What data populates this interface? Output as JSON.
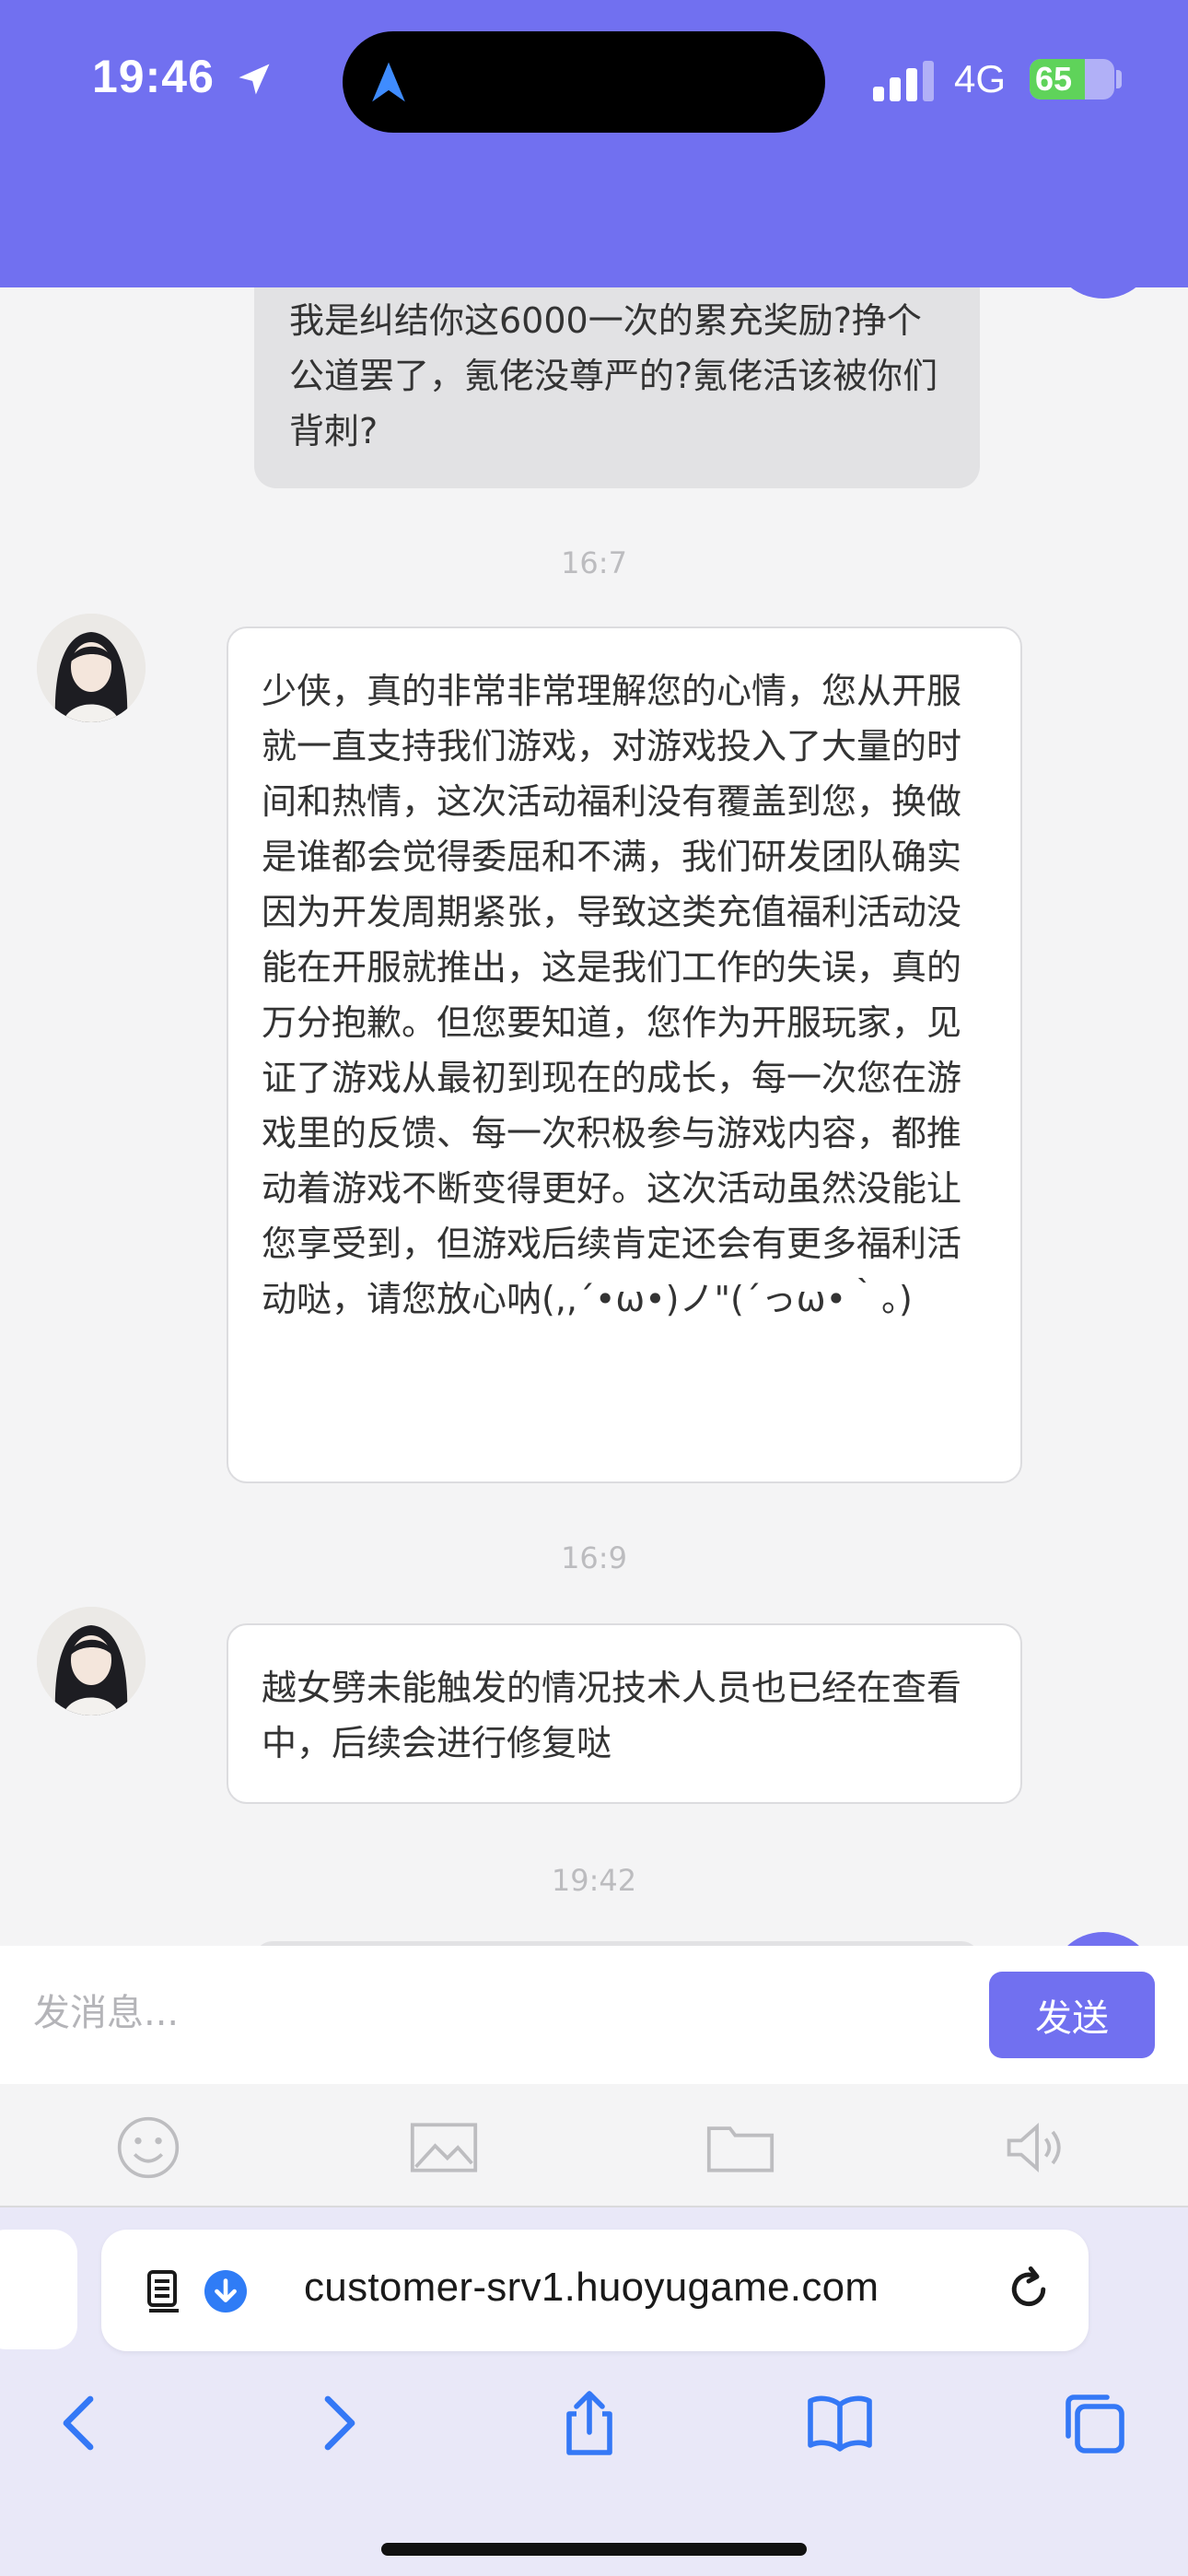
{
  "status_bar": {
    "time": "19:46",
    "network": "4G",
    "battery": "65",
    "battery_level": 0.65
  },
  "messages": [
    {
      "type": "mine",
      "text": "我是纠结你这6000一次的累充奖励?挣个公道罢了，氪佬没尊严的?氪佬活该被你们背刺?"
    },
    {
      "type": "timestamp",
      "text": "16:7"
    },
    {
      "type": "agent",
      "text": "少侠，真的非常非常理解您的心情，您从开服就一直支持我们游戏，对游戏投入了大量的时间和热情，这次活动福利没有覆盖到您，换做是谁都会觉得委屈和不满，我们研发团队确实因为开发周期紧张，导致这类充值福利活动没能在开服就推出，这是我们工作的失误，真的万分抱歉。但您要知道，您作为开服玩家，见证了游戏从最初到现在的成长，每一次您在游戏里的反馈、每一次积极参与游戏内容，都推动着游戏不断变得更好。这次活动虽然没能让您享受到，但游戏后续肯定还会有更多福利活动哒，请您放心呐(,,´•ω•)ノ\"(´っω•｀。)"
    },
    {
      "type": "timestamp",
      "text": "16:9"
    },
    {
      "type": "agent",
      "text": "越女劈未能触发的情况技术人员也已经在查看中，后续会进行修复哒"
    },
    {
      "type": "timestamp",
      "text": "19:42"
    }
  ],
  "input": {
    "placeholder": "发消息...",
    "value": "",
    "send_label": "发送"
  },
  "toolbar": {
    "items": [
      "emoji-icon",
      "image-icon",
      "folder-icon",
      "voice-icon"
    ]
  },
  "browser": {
    "url": "customer-srv1.huoyugame.com"
  },
  "colors": {
    "accent": "#7170f0",
    "bubble_mine": "#e2e2e4",
    "bubble_agent": "#ffffff",
    "page_bg": "#f4f4f5"
  }
}
